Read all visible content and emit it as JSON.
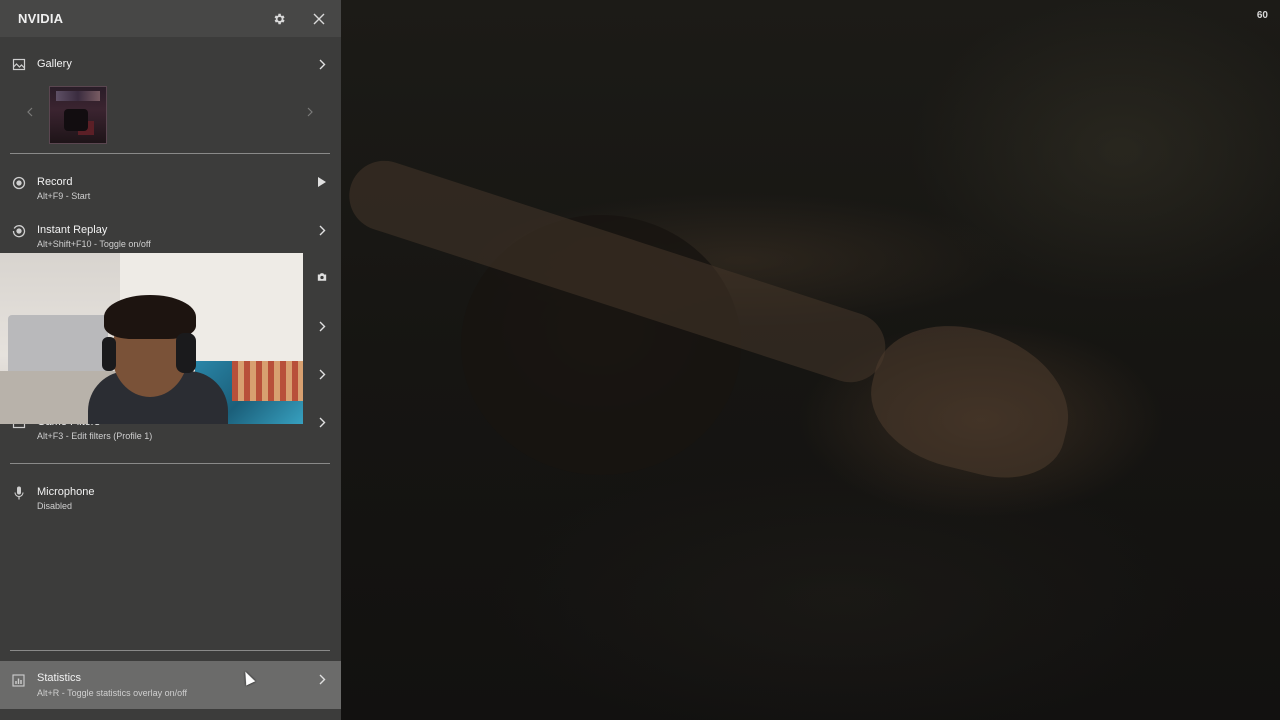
{
  "overlay": {
    "title": "NVIDIA",
    "header_icons": [
      "gear-icon",
      "close-icon"
    ],
    "fps": "60"
  },
  "menu": {
    "gallery": {
      "label": "Gallery",
      "icon": "gallery-icon"
    },
    "record": {
      "label": "Record",
      "subtitle": "Alt+F9 - Start",
      "icon": "record-icon"
    },
    "instant_replay": {
      "label": "Instant Replay",
      "subtitle": "Alt+Shift+F10 - Toggle on/off",
      "icon": "instant-replay-icon"
    },
    "game_filters": {
      "label": "Game Filters",
      "subtitle": "Alt+F3 - Edit filters (Profile 1)",
      "icon": "filter-icon"
    },
    "microphone": {
      "label": "Microphone",
      "subtitle": "Disabled",
      "icon": "microphone-icon"
    },
    "statistics": {
      "label": "Statistics",
      "subtitle": "Alt+R - Toggle statistics overlay on/off",
      "icon": "statistics-icon"
    }
  },
  "colors": {
    "panel_bg": "#3c3c3b",
    "header_bg": "#474746",
    "highlight_bg": "#6b6b6a",
    "divider": "#8a8a89"
  }
}
